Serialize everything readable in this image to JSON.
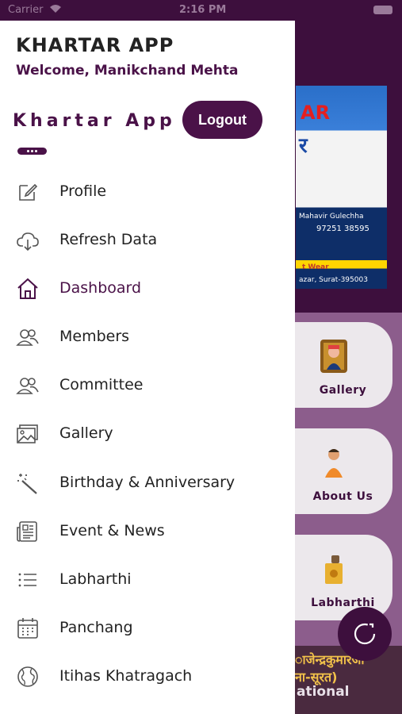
{
  "status_bar": {
    "carrier": "Carrier",
    "time": "2:16 PM"
  },
  "drawer": {
    "app_name": "KHARTAR APP",
    "welcome": "Welcome, Manikchand Mehta",
    "brand": "Khartar App",
    "logout_label": "Logout",
    "menu": [
      {
        "label": "Profile",
        "icon": "edit-icon",
        "active": false
      },
      {
        "label": "Refresh Data",
        "icon": "cloud-download-icon",
        "active": false
      },
      {
        "label": "Dashboard",
        "icon": "home-icon",
        "active": true
      },
      {
        "label": "Members",
        "icon": "users-icon",
        "active": false
      },
      {
        "label": "Committee",
        "icon": "users-icon",
        "active": false
      },
      {
        "label": "Gallery",
        "icon": "image-icon",
        "active": false
      },
      {
        "label": "Birthday & Anniversary",
        "icon": "magic-wand-icon",
        "active": false
      },
      {
        "label": "Event & News",
        "icon": "newspaper-icon",
        "active": false
      },
      {
        "label": "Labharthi",
        "icon": "list-icon",
        "active": false
      },
      {
        "label": "Panchang",
        "icon": "calendar-icon",
        "active": false
      },
      {
        "label": "Itihas Khatragach",
        "icon": "globe-icon",
        "active": false
      }
    ]
  },
  "background": {
    "banner": {
      "title": "AR",
      "subtitle": "र",
      "owner": "Mahavir Gulechha",
      "phone": "97251 38595",
      "wear": "t Wear",
      "address": "azar, Surat-395003"
    },
    "tiles": [
      {
        "label": "Gallery",
        "icon": "portrait-frame-icon"
      },
      {
        "label": "About Us",
        "icon": "person-icon"
      },
      {
        "label": "Labharthi",
        "icon": "donation-box-icon"
      }
    ],
    "bottom": {
      "line1": "ाजेन्द्रकुमारजी",
      "line2": "ना-सूरत)",
      "line3": "ational"
    }
  },
  "colors": {
    "accent": "#4a1248",
    "header_bg": "#3d0f3d",
    "tiles_bg": "#8c5d8c"
  }
}
